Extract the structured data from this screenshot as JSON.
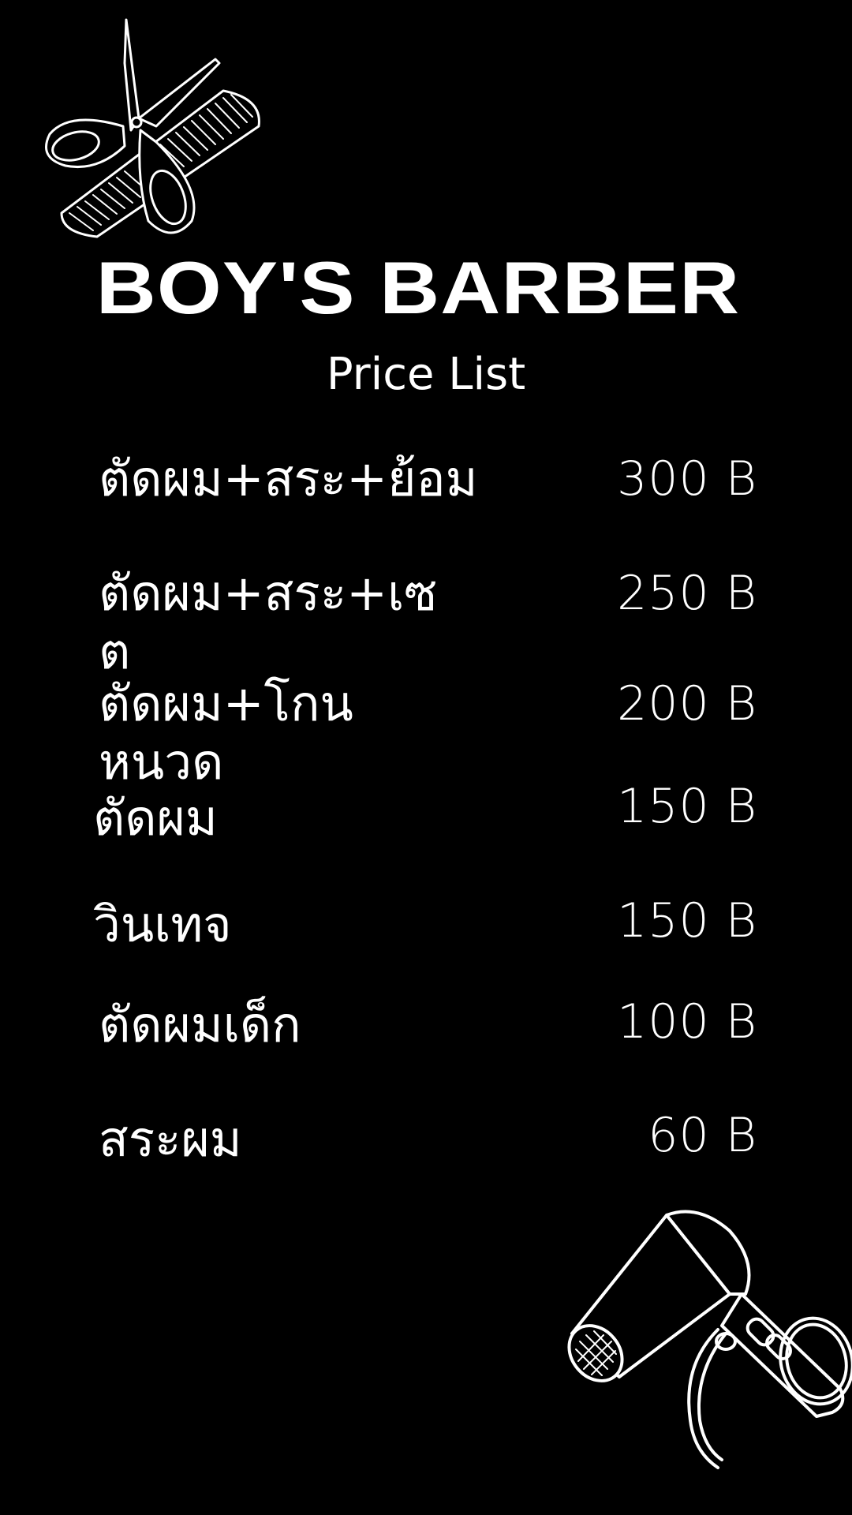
{
  "header": {
    "title": "BOY'S BARBER",
    "subtitle": "Price List"
  },
  "icons": {
    "top_left": "scissors-comb-icon",
    "bottom_right": "hair-dryer-icon"
  },
  "menu": {
    "items": [
      {
        "name": "ตัดผม+สระ+ย้อม",
        "price": "300 B"
      },
      {
        "name": "ตัดผม+สระ+เซต",
        "price": "250 B"
      },
      {
        "name": "ตัดผม+โกนหนวด",
        "price": "200 B"
      },
      {
        "name": "ตัดผม",
        "price": "150 B"
      },
      {
        "name": "วินเทจ",
        "price": "150 B"
      },
      {
        "name": "ตัดผมเด็ก",
        "price": "100 B"
      },
      {
        "name": "สระผม",
        "price": "60 B"
      }
    ]
  },
  "colors": {
    "background": "#000000",
    "text": "#ffffff"
  }
}
